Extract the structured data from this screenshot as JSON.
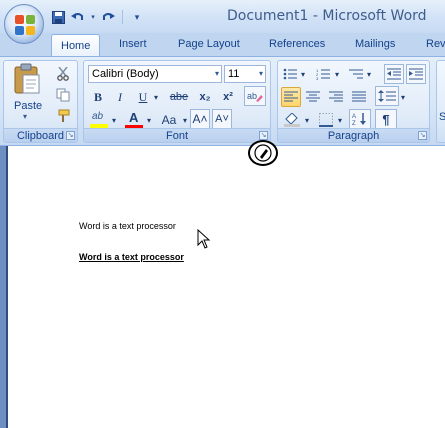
{
  "window": {
    "title": "Document1 - Microsoft Word"
  },
  "quick_access": {
    "icons": [
      "save-icon",
      "undo-icon",
      "redo-icon",
      "customize-icon"
    ]
  },
  "tabs": [
    {
      "label": "Home",
      "active": true
    },
    {
      "label": "Insert"
    },
    {
      "label": "Page Layout"
    },
    {
      "label": "References"
    },
    {
      "label": "Mailings"
    },
    {
      "label": "Rev"
    }
  ],
  "ribbon": {
    "clipboard": {
      "label": "Clipboard",
      "paste_label": "Paste"
    },
    "font": {
      "label": "Font",
      "font_name": "Calibri (Body)",
      "font_size": "11",
      "bold": "B",
      "italic": "I",
      "underline": "U",
      "strikethrough": "abe",
      "subscript": "x₂",
      "superscript": "x²",
      "grow_font": "A˄",
      "shrink_font": "A˅",
      "change_case": "Aa",
      "highlight": "ab",
      "font_color": "A"
    },
    "paragraph": {
      "label": "Paragraph",
      "pilcrow": "¶"
    },
    "styles": {
      "label_fragment": "S"
    }
  },
  "document": {
    "lines": [
      "Word is a text processor",
      "Word is a text processor"
    ]
  },
  "colors": {
    "accent": "#15428b",
    "ribbon_bg": "#d6e5f7",
    "highlight": "#ffff00",
    "font_color_bar": "#ff0000"
  }
}
